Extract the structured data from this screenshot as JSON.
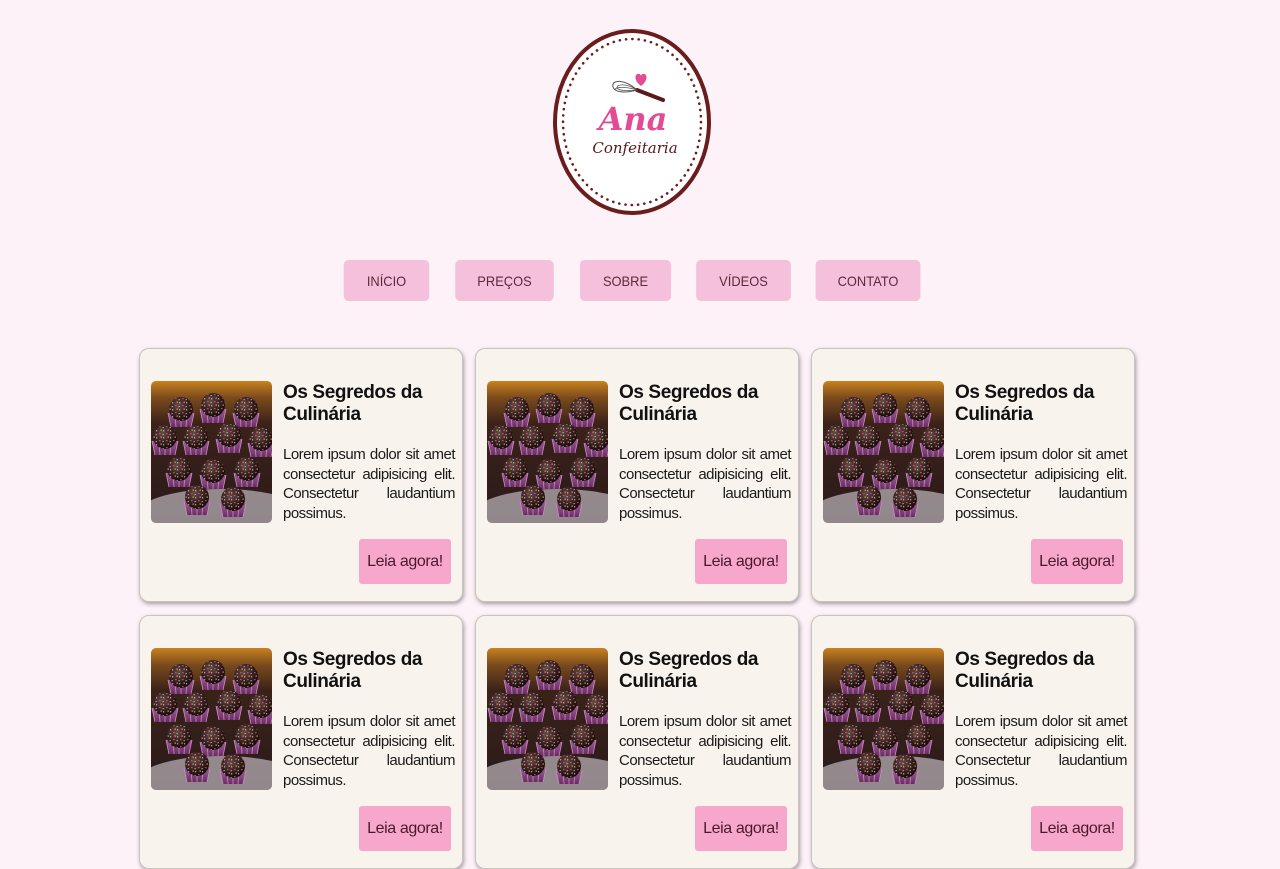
{
  "brand": {
    "name": "Ana",
    "tagline": "Confeitaria"
  },
  "nav": {
    "items": [
      {
        "label": "INÍCIO"
      },
      {
        "label": "PREÇOS"
      },
      {
        "label": "SOBRE"
      },
      {
        "label": "VÍDEOS"
      },
      {
        "label": "CONTATO"
      }
    ]
  },
  "cards": [
    {
      "title": "Os Segredos da Culinária",
      "text": "Lorem ipsum dolor sit amet consectetur adipisicing elit. Consectetur laudantium possimus.",
      "button": "Leia agora!",
      "image_icon": "brigadeiro-photo"
    },
    {
      "title": "Os Segredos da Culinária",
      "text": "Lorem ipsum dolor sit amet consectetur adipisicing elit. Consectetur laudantium possimus.",
      "button": "Leia agora!",
      "image_icon": "brigadeiro-photo"
    },
    {
      "title": "Os Segredos da Culinária",
      "text": "Lorem ipsum dolor sit amet consectetur adipisicing elit. Consectetur laudantium possimus.",
      "button": "Leia agora!",
      "image_icon": "brigadeiro-photo"
    },
    {
      "title": "Os Segredos da Culinária",
      "text": "Lorem ipsum dolor sit amet consectetur adipisicing elit. Consectetur laudantium possimus.",
      "button": "Leia agora!",
      "image_icon": "brigadeiro-photo"
    },
    {
      "title": "Os Segredos da Culinária",
      "text": "Lorem ipsum dolor sit amet consectetur adipisicing elit. Consectetur laudantium possimus.",
      "button": "Leia agora!",
      "image_icon": "brigadeiro-photo"
    },
    {
      "title": "Os Segredos da Culinária",
      "text": "Lorem ipsum dolor sit amet consectetur adipisicing elit. Consectetur laudantium possimus.",
      "button": "Leia agora!",
      "image_icon": "brigadeiro-photo"
    }
  ],
  "colors": {
    "page_bg": "#fdf2f8",
    "nav_button": "#f5c0dc",
    "card_bg": "#f8f3ed",
    "card_button": "#f7a6cc",
    "logo_ring": "#6b1d1d",
    "logo_pink": "#e44b95"
  }
}
